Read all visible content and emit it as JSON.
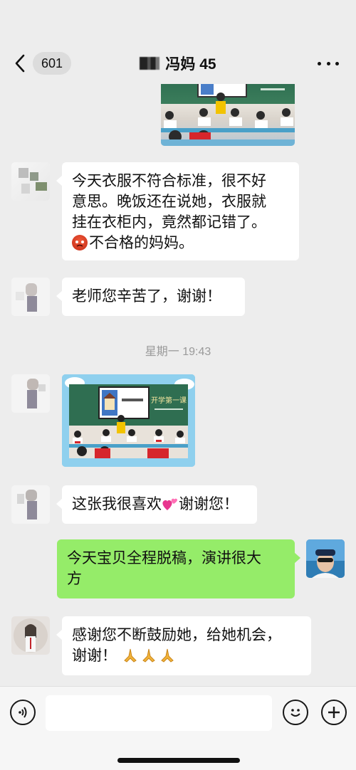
{
  "header": {
    "unread_count": "601",
    "title": "冯妈 45"
  },
  "messages": [
    {
      "from": "other",
      "type": "text",
      "lines": [
        "今天衣服不符合标准，很不好",
        "意思。晚饭还在说她，衣服就",
        "挂在衣柜内，竟然都记错了。"
      ],
      "emoji": "angry-face",
      "last_line_text": "不合格的妈妈。"
    },
    {
      "from": "other",
      "type": "text",
      "text": "老师您辛苦了，谢谢！"
    },
    {
      "from": "system",
      "type": "timestamp",
      "text": "星期一 19:43"
    },
    {
      "from": "other",
      "type": "image",
      "image": "classroom-photo",
      "slide_title": "开学第一课"
    },
    {
      "from": "other",
      "type": "text",
      "before_emoji": "这张我很喜欢",
      "emoji": "two-hearts",
      "after_emoji": "谢谢您！"
    },
    {
      "from": "me",
      "type": "text",
      "lines": [
        "今天宝贝全程脱稿，演讲很大",
        "方"
      ]
    },
    {
      "from": "other",
      "type": "text",
      "lines": [
        "感谢您不断鼓励她，给她机会，",
        "谢谢！"
      ],
      "emoji": "folded-hands"
    }
  ],
  "input": {
    "placeholder": ""
  },
  "colors": {
    "background": "#ededed",
    "bubble_other": "#ffffff",
    "bubble_mine": "#95ec69",
    "timestamp": "#9a9a9a"
  }
}
